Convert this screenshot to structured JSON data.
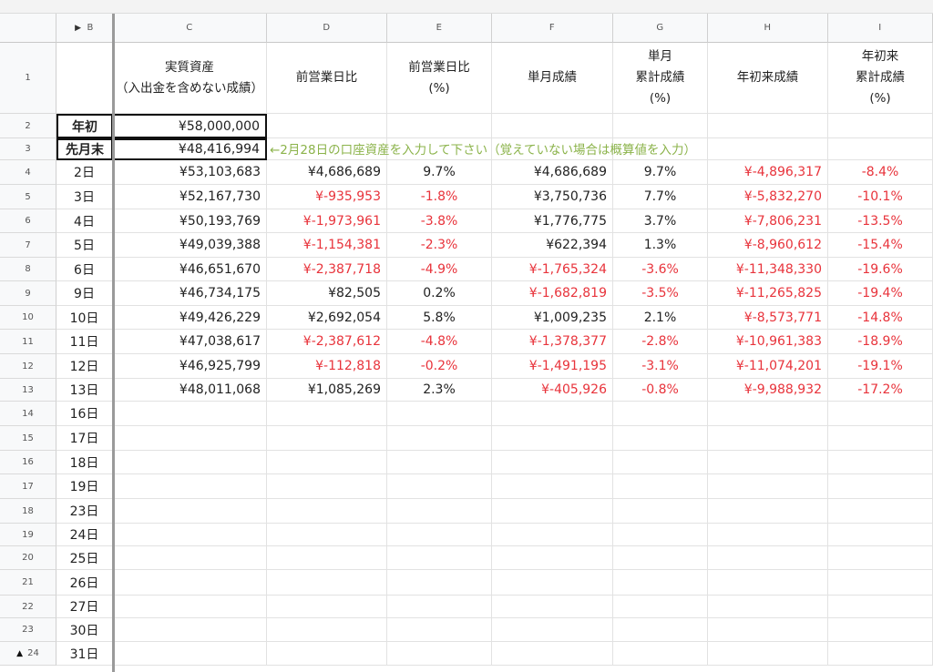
{
  "columns": {
    "b": "B",
    "c": "C",
    "d": "D",
    "e": "E",
    "f": "F",
    "g": "G",
    "h": "H",
    "i": "I"
  },
  "headers": {
    "c_line1": "実質資産",
    "c_line2": "（入出金を含めない成績）",
    "d": "前営業日比",
    "e_line1": "前営業日比",
    "e_line2": "(%)",
    "f": "単月成績",
    "g_line1": "単月",
    "g_line2": "累計成績",
    "g_line3": "(%)",
    "h": "年初来成績",
    "i_line1": "年初来",
    "i_line2": "累計成績",
    "i_line3": "(%)"
  },
  "row_numbers": [
    "1",
    "2",
    "3",
    "4",
    "5",
    "6",
    "7",
    "8",
    "9",
    "10",
    "11",
    "12",
    "13",
    "14",
    "15",
    "16",
    "17",
    "18",
    "19",
    "20",
    "21",
    "22",
    "23",
    "24"
  ],
  "anchors": [
    {
      "label": "年初",
      "asset": "¥58,000,000"
    },
    {
      "label": "先月末",
      "asset": "¥48,416,994"
    }
  ],
  "note": "←2月28日の口座資産を入力して下さい（覚えていない場合は概算値を入力）",
  "rows": [
    {
      "day": "2日",
      "asset": "¥53,103,683",
      "diff": "¥4,686,689",
      "diff_pct": "9.7%",
      "month": "¥4,686,689",
      "month_pct": "9.7%",
      "ytd": "¥-4,896,317",
      "ytd_pct": "-8.4%"
    },
    {
      "day": "3日",
      "asset": "¥52,167,730",
      "diff": "¥-935,953",
      "diff_pct": "-1.8%",
      "month": "¥3,750,736",
      "month_pct": "7.7%",
      "ytd": "¥-5,832,270",
      "ytd_pct": "-10.1%"
    },
    {
      "day": "4日",
      "asset": "¥50,193,769",
      "diff": "¥-1,973,961",
      "diff_pct": "-3.8%",
      "month": "¥1,776,775",
      "month_pct": "3.7%",
      "ytd": "¥-7,806,231",
      "ytd_pct": "-13.5%"
    },
    {
      "day": "5日",
      "asset": "¥49,039,388",
      "diff": "¥-1,154,381",
      "diff_pct": "-2.3%",
      "month": "¥622,394",
      "month_pct": "1.3%",
      "ytd": "¥-8,960,612",
      "ytd_pct": "-15.4%"
    },
    {
      "day": "6日",
      "asset": "¥46,651,670",
      "diff": "¥-2,387,718",
      "diff_pct": "-4.9%",
      "month": "¥-1,765,324",
      "month_pct": "-3.6%",
      "ytd": "¥-11,348,330",
      "ytd_pct": "-19.6%"
    },
    {
      "day": "9日",
      "asset": "¥46,734,175",
      "diff": "¥82,505",
      "diff_pct": "0.2%",
      "month": "¥-1,682,819",
      "month_pct": "-3.5%",
      "ytd": "¥-11,265,825",
      "ytd_pct": "-19.4%"
    },
    {
      "day": "10日",
      "asset": "¥49,426,229",
      "diff": "¥2,692,054",
      "diff_pct": "5.8%",
      "month": "¥1,009,235",
      "month_pct": "2.1%",
      "ytd": "¥-8,573,771",
      "ytd_pct": "-14.8%"
    },
    {
      "day": "11日",
      "asset": "¥47,038,617",
      "diff": "¥-2,387,612",
      "diff_pct": "-4.8%",
      "month": "¥-1,378,377",
      "month_pct": "-2.8%",
      "ytd": "¥-10,961,383",
      "ytd_pct": "-18.9%"
    },
    {
      "day": "12日",
      "asset": "¥46,925,799",
      "diff": "¥-112,818",
      "diff_pct": "-0.2%",
      "month": "¥-1,491,195",
      "month_pct": "-3.1%",
      "ytd": "¥-11,074,201",
      "ytd_pct": "-19.1%"
    },
    {
      "day": "13日",
      "asset": "¥48,011,068",
      "diff": "¥1,085,269",
      "diff_pct": "2.3%",
      "month": "¥-405,926",
      "month_pct": "-0.8%",
      "ytd": "¥-9,988,932",
      "ytd_pct": "-17.2%"
    },
    {
      "day": "16日"
    },
    {
      "day": "17日"
    },
    {
      "day": "18日"
    },
    {
      "day": "19日"
    },
    {
      "day": "23日"
    },
    {
      "day": "24日"
    },
    {
      "day": "25日"
    },
    {
      "day": "26日"
    },
    {
      "day": "27日"
    },
    {
      "day": "30日"
    },
    {
      "day": "31日"
    }
  ],
  "colors": {
    "negative": "#e8333b",
    "note": "#8bb34a"
  }
}
